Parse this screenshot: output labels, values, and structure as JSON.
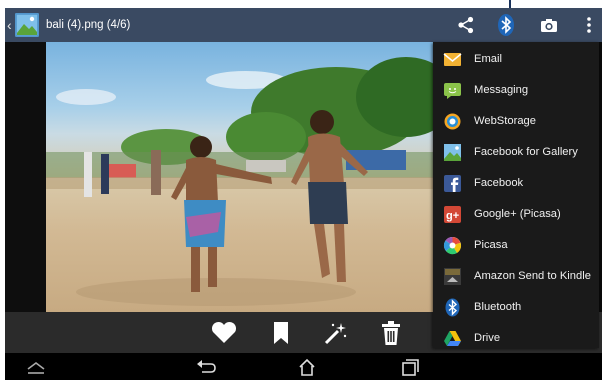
{
  "action_bar": {
    "title": "bali (4).png (4/6)",
    "icons": [
      "back-icon",
      "image-thumbnail-icon",
      "share-icon",
      "bluetooth-icon",
      "camera-icon",
      "more-icon"
    ]
  },
  "share_menu": {
    "items": [
      {
        "label": "Email",
        "icon": "email-icon"
      },
      {
        "label": "Messaging",
        "icon": "messaging-icon"
      },
      {
        "label": "WebStorage",
        "icon": "webstorage-icon"
      },
      {
        "label": "Facebook for Gallery",
        "icon": "facebook-gallery-icon"
      },
      {
        "label": "Facebook",
        "icon": "facebook-icon"
      },
      {
        "label": "Google+ (Picasa)",
        "icon": "google-plus-icon"
      },
      {
        "label": "Picasa",
        "icon": "picasa-icon"
      },
      {
        "label": "Amazon Send to Kindle",
        "icon": "kindle-icon"
      },
      {
        "label": "Bluetooth",
        "icon": "bluetooth-icon"
      },
      {
        "label": "Drive",
        "icon": "drive-icon"
      }
    ]
  },
  "bottom_bar": {
    "icons": [
      "heart-icon",
      "bookmark-icon",
      "magic-wand-icon",
      "trash-icon"
    ]
  },
  "nav_bar": {
    "icons": [
      "collapse-icon",
      "back-nav-icon",
      "home-icon",
      "recent-apps-icon"
    ]
  },
  "colors": {
    "action_bar": "#3a4a62",
    "menu_bg": "#1a1a1a",
    "menu_text": "#f0f0f0"
  }
}
